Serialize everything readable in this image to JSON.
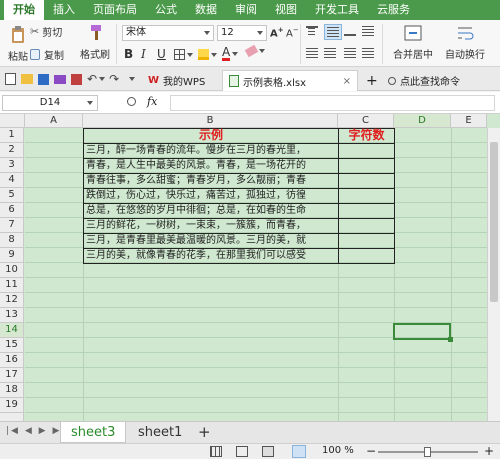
{
  "menu": {
    "items": [
      "开始",
      "插入",
      "页面布局",
      "公式",
      "数据",
      "审阅",
      "视图",
      "开发工具",
      "云服务"
    ],
    "active_index": 0
  },
  "ribbon": {
    "paste": "粘贴",
    "cut": "剪切",
    "copy": "复制",
    "format_painter": "格式刷",
    "font_name": "宋体",
    "font_size": "12",
    "bold": "B",
    "italic": "I",
    "underline": "U",
    "font_color_glyph": "A",
    "merge_center": "合并居中",
    "auto_wrap": "自动换行"
  },
  "tabbar": {
    "wps_tab": "我的WPS",
    "doc_tab": "示例表格.xlsx",
    "add_tab": "+",
    "search_cmd": "点此查找命令"
  },
  "formula_bar": {
    "name_box": "D14",
    "fx": "fx",
    "formula": ""
  },
  "columns": [
    "A",
    "B",
    "C",
    "D",
    "E"
  ],
  "rows": [
    "1",
    "2",
    "3",
    "4",
    "5",
    "6",
    "7",
    "8",
    "9",
    "10",
    "11",
    "12",
    "13",
    "14",
    "15",
    "16",
    "17",
    "18",
    "19"
  ],
  "table": {
    "title": "示例",
    "header_c": "字符数",
    "lines": [
      "三月，醉一场青春的流年。慢步在三月的春光里，",
      "青春，是人生中最美的风景。青春，是一场花开的",
      "青春往事，多么甜蜜；青春岁月，多么靓丽；青春",
      "跌倒过，伤心过，快乐过，痛苦过，孤独过，彷徨",
      "总是，在悠悠的岁月中徘徊；总是，在如春的生命",
      "三月的鲜花，一树树，一束束，一簇簇，而青春，",
      "三月，是青春里最美最温暖的风景。三月的美，就",
      "三月的美，就像青春的花季，在那里我们可以感受"
    ]
  },
  "sheet_tabs": {
    "tabs": [
      "sheet3",
      "sheet1"
    ],
    "active_index": 0,
    "add": "+"
  },
  "status": {
    "zoom": "100 %",
    "minus": "−",
    "plus": "+"
  },
  "colors": {
    "menu_green": "#4b9a4b",
    "sheet_green": "#cfe8cf",
    "title_red": "#e02020",
    "selection": "#3a8a3a"
  }
}
